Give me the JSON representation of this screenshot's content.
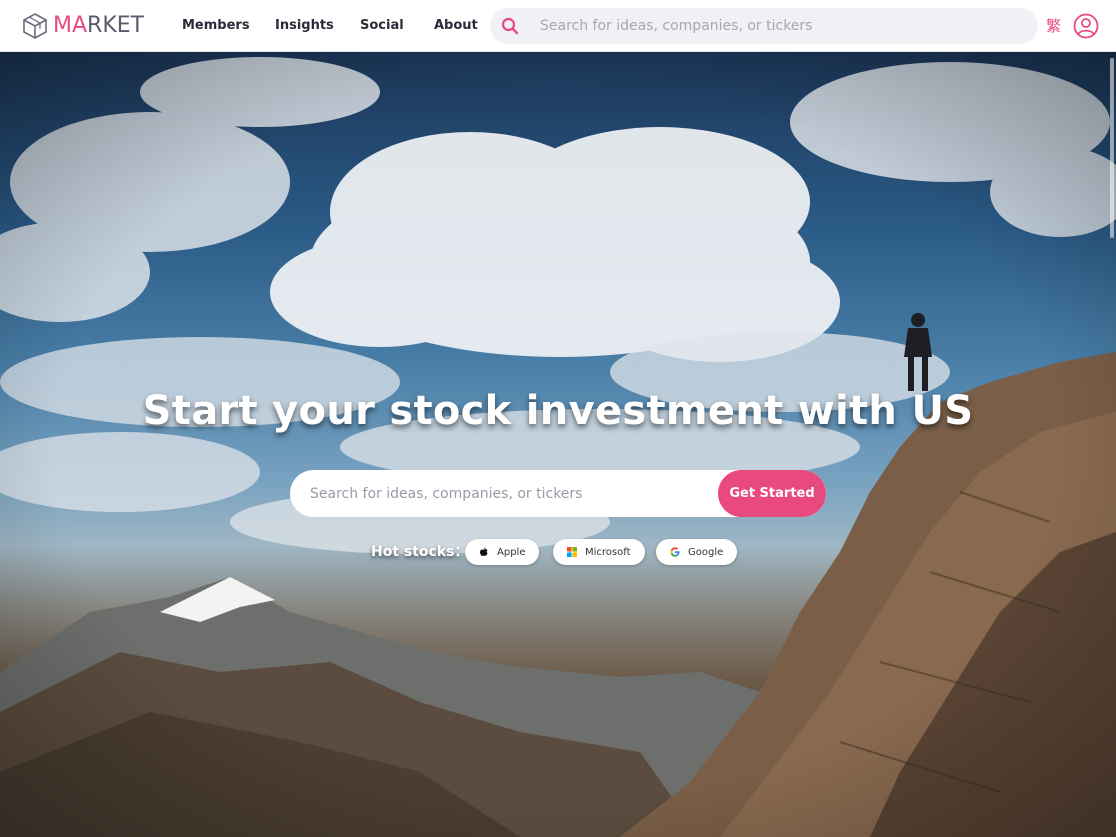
{
  "brand": {
    "logo_part1": "MA",
    "logo_part2": "RKET",
    "accent": "#e84a7f"
  },
  "nav": {
    "links": [
      "Members",
      "Insights",
      "Social",
      "About"
    ],
    "search_placeholder": "Search for ideas, companies, or tickers",
    "language_toggle": "繁"
  },
  "hero": {
    "headline": "Start your stock investment with US",
    "search_placeholder": "Search for ideas, companies, or tickers",
    "cta_label": "Get Started",
    "hot_label": "Hot stocks：",
    "hot_stocks": [
      {
        "name": "Apple",
        "icon": "apple-icon"
      },
      {
        "name": "Microsoft",
        "icon": "microsoft-icon"
      },
      {
        "name": "Google",
        "icon": "google-icon"
      }
    ]
  }
}
